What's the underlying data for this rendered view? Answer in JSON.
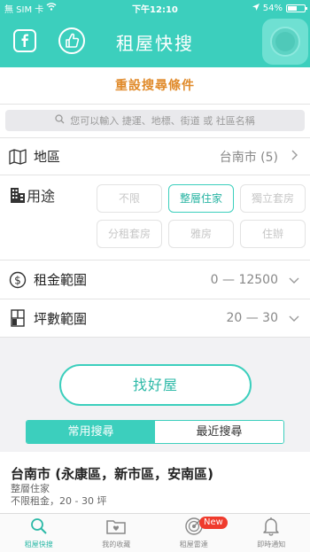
{
  "statusbar": {
    "carrier": "無 SIM 卡",
    "time": "下午12:10",
    "battery": "54%",
    "battery_level": 0.54
  },
  "appbar": {
    "title": "租屋快搜"
  },
  "reset_label": "重設搜尋條件",
  "search": {
    "placeholder": "您可以輸入 捷運、地標、街道 或 社區名稱"
  },
  "area": {
    "label": "地區",
    "value": "台南市 (5)"
  },
  "usage": {
    "label": "用途",
    "options": [
      {
        "label": "不限",
        "selected": false
      },
      {
        "label": "整層住家",
        "selected": true
      },
      {
        "label": "獨立套房",
        "selected": false
      },
      {
        "label": "分租套房",
        "selected": false
      },
      {
        "label": "雅房",
        "selected": false
      },
      {
        "label": "住辦",
        "selected": false
      }
    ]
  },
  "rent": {
    "label": "租金範圍",
    "value": "0 — 12500"
  },
  "size": {
    "label": "坪數範圍",
    "value": "20 — 30"
  },
  "find_button": "找好屋",
  "segments": {
    "common": "常用搜尋",
    "recent": "最近搜尋"
  },
  "result": {
    "title": "台南市 (永康區，新市區，安南區)",
    "line1": "整層住家",
    "line2": "不限租金，20 - 30 坪"
  },
  "tabs": [
    {
      "label": "租屋快搜",
      "icon": "search-icon"
    },
    {
      "label": "我的收藏",
      "icon": "folder-heart-icon"
    },
    {
      "label": "租屋雷達",
      "icon": "radar-icon",
      "badge": "New"
    },
    {
      "label": "即時通知",
      "icon": "bell-icon"
    }
  ],
  "colors": {
    "accent": "#3ccfbd",
    "reset": "#e08a2a",
    "badge": "#ef3b2d"
  }
}
